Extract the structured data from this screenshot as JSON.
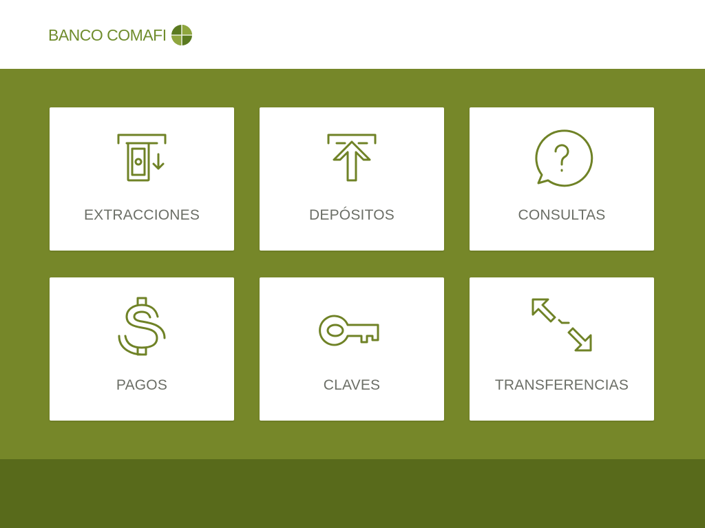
{
  "brand": {
    "name": "BANCO COMAFI",
    "color": "#6f8c2c"
  },
  "colors": {
    "main_background": "#768729",
    "footer_background": "#586a1b",
    "tile_background": "#ffffff",
    "icon_color": "#6f8226",
    "label_color": "#6b6e66"
  },
  "menu": {
    "items": [
      {
        "label": "EXTRACCIONES",
        "icon": "cash-withdrawal-icon"
      },
      {
        "label": "DEPÓSITOS",
        "icon": "deposit-arrow-icon"
      },
      {
        "label": "CONSULTAS",
        "icon": "question-bubble-icon"
      },
      {
        "label": "PAGOS",
        "icon": "dollar-sign-icon"
      },
      {
        "label": "CLAVES",
        "icon": "key-icon"
      },
      {
        "label": "TRANSFERENCIAS",
        "icon": "transfer-arrows-icon"
      }
    ]
  }
}
